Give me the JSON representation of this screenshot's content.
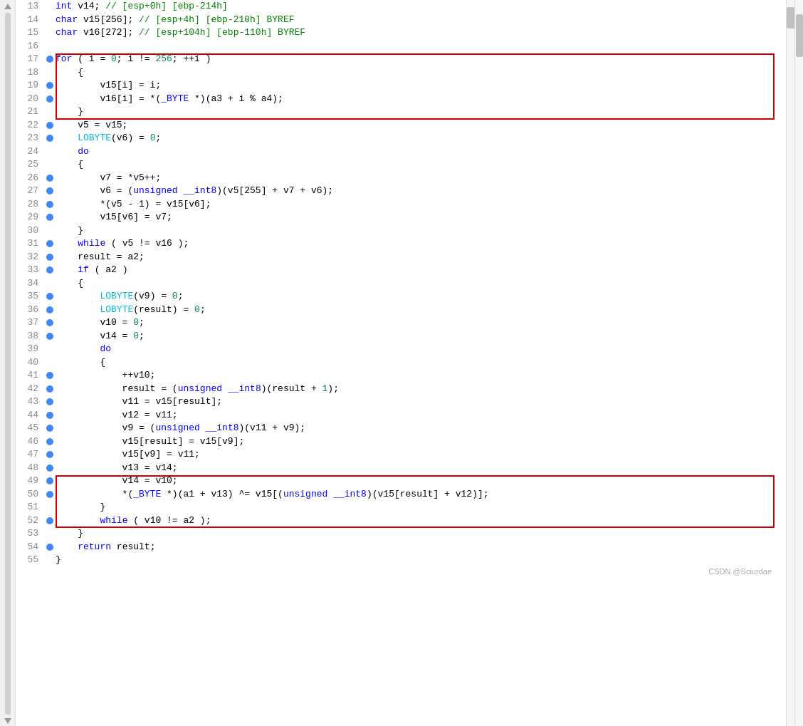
{
  "editor": {
    "background": "#ffffff",
    "lines": [
      {
        "num": "13",
        "has_bp": false,
        "highlighted": false,
        "tokens": [
          {
            "t": "type",
            "v": "int"
          },
          {
            "t": "plain",
            "v": " v14; // [esp+0h] [ebp-214h]"
          }
        ]
      },
      {
        "num": "14",
        "has_bp": false,
        "highlighted": false,
        "tokens": [
          {
            "t": "type",
            "v": "char"
          },
          {
            "t": "plain",
            "v": " v15[256]; // [esp+4h] [ebp-210h] BYREF"
          }
        ]
      },
      {
        "num": "15",
        "has_bp": false,
        "highlighted": false,
        "tokens": [
          {
            "t": "type",
            "v": "char"
          },
          {
            "t": "plain",
            "v": " v16[272]; // [esp+104h] [ebp-110h] BYREF"
          }
        ]
      },
      {
        "num": "16",
        "has_bp": false,
        "highlighted": false,
        "tokens": []
      },
      {
        "num": "17",
        "has_bp": true,
        "highlighted": false,
        "in_red_box_1": true,
        "tokens": [
          {
            "t": "kw",
            "v": "for"
          },
          {
            "t": "plain",
            "v": " ( i = "
          },
          {
            "t": "num",
            "v": "0"
          },
          {
            "t": "plain",
            "v": "; i != "
          },
          {
            "t": "num",
            "v": "256"
          },
          {
            "t": "plain",
            "v": "; ++i )"
          }
        ]
      },
      {
        "num": "18",
        "has_bp": false,
        "highlighted": false,
        "in_red_box_1": true,
        "tokens": [
          {
            "t": "plain",
            "v": "    {"
          }
        ]
      },
      {
        "num": "19",
        "has_bp": true,
        "highlighted": false,
        "in_red_box_1": true,
        "tokens": [
          {
            "t": "plain",
            "v": "        v15[i] = i;"
          }
        ]
      },
      {
        "num": "20",
        "has_bp": true,
        "highlighted": false,
        "in_red_box_1": true,
        "tokens": [
          {
            "t": "plain",
            "v": "        v16[i] = *("
          },
          {
            "t": "kw",
            "v": "_BYTE"
          },
          {
            "t": "plain",
            "v": " *)(a3 + i % a4);"
          }
        ]
      },
      {
        "num": "21",
        "has_bp": false,
        "highlighted": false,
        "in_red_box_1": true,
        "tokens": [
          {
            "t": "plain",
            "v": "    }"
          }
        ]
      },
      {
        "num": "22",
        "has_bp": true,
        "highlighted": false,
        "tokens": [
          {
            "t": "plain",
            "v": "    v5 = v15;"
          }
        ]
      },
      {
        "num": "23",
        "has_bp": true,
        "highlighted": false,
        "tokens": [
          {
            "t": "cyan",
            "v": "    LOBYTE"
          },
          {
            "t": "plain",
            "v": "(v6) = "
          },
          {
            "t": "num",
            "v": "0"
          },
          {
            "t": "plain",
            "v": ";"
          }
        ]
      },
      {
        "num": "24",
        "has_bp": false,
        "highlighted": false,
        "tokens": [
          {
            "t": "plain",
            "v": "    "
          },
          {
            "t": "kw",
            "v": "do"
          }
        ]
      },
      {
        "num": "25",
        "has_bp": false,
        "highlighted": false,
        "tokens": [
          {
            "t": "plain",
            "v": "    {"
          }
        ]
      },
      {
        "num": "26",
        "has_bp": true,
        "highlighted": false,
        "tokens": [
          {
            "t": "plain",
            "v": "        v7 = *v5++;"
          }
        ]
      },
      {
        "num": "27",
        "has_bp": true,
        "highlighted": false,
        "tokens": [
          {
            "t": "plain",
            "v": "        v6 = ("
          },
          {
            "t": "kw",
            "v": "unsigned"
          },
          {
            "t": "plain",
            "v": " "
          },
          {
            "t": "kw",
            "v": "__int8"
          },
          {
            "t": "plain",
            "v": ")(v5[255] + v7 + v6);"
          }
        ]
      },
      {
        "num": "28",
        "has_bp": true,
        "highlighted": false,
        "tokens": [
          {
            "t": "plain",
            "v": "        *(v5 - 1) = v15[v6];"
          }
        ]
      },
      {
        "num": "29",
        "has_bp": true,
        "highlighted": false,
        "tokens": [
          {
            "t": "plain",
            "v": "        v15[v6] = v7;"
          }
        ]
      },
      {
        "num": "30",
        "has_bp": false,
        "highlighted": false,
        "tokens": [
          {
            "t": "plain",
            "v": "    }"
          }
        ]
      },
      {
        "num": "31",
        "has_bp": true,
        "highlighted": false,
        "tokens": [
          {
            "t": "plain",
            "v": "    "
          },
          {
            "t": "kw",
            "v": "while"
          },
          {
            "t": "plain",
            "v": " ( v5 != v16 );"
          }
        ]
      },
      {
        "num": "32",
        "has_bp": true,
        "highlighted": false,
        "tokens": [
          {
            "t": "plain",
            "v": "    result = a2;"
          }
        ]
      },
      {
        "num": "33",
        "has_bp": true,
        "highlighted": false,
        "tokens": [
          {
            "t": "plain",
            "v": "    "
          },
          {
            "t": "kw",
            "v": "if"
          },
          {
            "t": "plain",
            "v": " ( a2 )"
          }
        ]
      },
      {
        "num": "34",
        "has_bp": false,
        "highlighted": false,
        "tokens": [
          {
            "t": "plain",
            "v": "    {"
          }
        ]
      },
      {
        "num": "35",
        "has_bp": true,
        "highlighted": false,
        "tokens": [
          {
            "t": "plain",
            "v": "        "
          },
          {
            "t": "cyan",
            "v": "LOBYTE"
          },
          {
            "t": "plain",
            "v": "(v9) = "
          },
          {
            "t": "num",
            "v": "0"
          },
          {
            "t": "plain",
            "v": ";"
          }
        ]
      },
      {
        "num": "36",
        "has_bp": true,
        "highlighted": false,
        "tokens": [
          {
            "t": "plain",
            "v": "        "
          },
          {
            "t": "cyan",
            "v": "LOBYTE"
          },
          {
            "t": "plain",
            "v": "(result) = "
          },
          {
            "t": "num",
            "v": "0"
          },
          {
            "t": "plain",
            "v": ";"
          }
        ]
      },
      {
        "num": "37",
        "has_bp": true,
        "highlighted": false,
        "tokens": [
          {
            "t": "plain",
            "v": "        v10 = "
          },
          {
            "t": "num",
            "v": "0"
          },
          {
            "t": "plain",
            "v": ";"
          }
        ]
      },
      {
        "num": "38",
        "has_bp": true,
        "highlighted": false,
        "tokens": [
          {
            "t": "plain",
            "v": "        v14 = "
          },
          {
            "t": "num",
            "v": "0"
          },
          {
            "t": "plain",
            "v": ";"
          }
        ]
      },
      {
        "num": "39",
        "has_bp": false,
        "highlighted": false,
        "tokens": [
          {
            "t": "plain",
            "v": "        "
          },
          {
            "t": "kw",
            "v": "do"
          }
        ]
      },
      {
        "num": "40",
        "has_bp": false,
        "highlighted": false,
        "tokens": [
          {
            "t": "plain",
            "v": "        {"
          }
        ]
      },
      {
        "num": "41",
        "has_bp": true,
        "highlighted": false,
        "tokens": [
          {
            "t": "plain",
            "v": "            ++v10;"
          }
        ]
      },
      {
        "num": "42",
        "has_bp": true,
        "highlighted": false,
        "tokens": [
          {
            "t": "plain",
            "v": "            result = ("
          },
          {
            "t": "kw",
            "v": "unsigned"
          },
          {
            "t": "plain",
            "v": " "
          },
          {
            "t": "kw",
            "v": "__int8"
          },
          {
            "t": "plain",
            "v": ")(result + "
          },
          {
            "t": "num",
            "v": "1"
          },
          {
            "t": "plain",
            "v": ");"
          }
        ]
      },
      {
        "num": "43",
        "has_bp": true,
        "highlighted": false,
        "tokens": [
          {
            "t": "plain",
            "v": "            v11 = v15[result];"
          }
        ]
      },
      {
        "num": "44",
        "has_bp": true,
        "highlighted": false,
        "tokens": [
          {
            "t": "plain",
            "v": "            v12 = v11;"
          }
        ]
      },
      {
        "num": "45",
        "has_bp": true,
        "highlighted": false,
        "tokens": [
          {
            "t": "plain",
            "v": "            v9 = ("
          },
          {
            "t": "kw",
            "v": "unsigned"
          },
          {
            "t": "plain",
            "v": " "
          },
          {
            "t": "kw",
            "v": "__int8"
          },
          {
            "t": "plain",
            "v": ")(v11 + v9);"
          }
        ]
      },
      {
        "num": "46",
        "has_bp": true,
        "highlighted": false,
        "tokens": [
          {
            "t": "plain",
            "v": "            v15[result] = v15[v9];"
          }
        ]
      },
      {
        "num": "47",
        "has_bp": true,
        "highlighted": false,
        "tokens": [
          {
            "t": "plain",
            "v": "            v15[v9] = v11;"
          }
        ]
      },
      {
        "num": "48",
        "has_bp": true,
        "highlighted": false,
        "tokens": [
          {
            "t": "plain",
            "v": "            v13 = v14;"
          }
        ]
      },
      {
        "num": "49",
        "has_bp": true,
        "highlighted": false,
        "in_red_box_2": true,
        "tokens": [
          {
            "t": "plain",
            "v": "            v14 = v10;"
          }
        ]
      },
      {
        "num": "50",
        "has_bp": true,
        "highlighted": false,
        "in_red_box_2": true,
        "tokens": [
          {
            "t": "plain",
            "v": "            *("
          },
          {
            "t": "kw",
            "v": "_BYTE"
          },
          {
            "t": "plain",
            "v": " *)(a1 + v13) ^= v15[("
          },
          {
            "t": "kw",
            "v": "unsigned"
          },
          {
            "t": "plain",
            "v": " "
          },
          {
            "t": "kw",
            "v": "__int8"
          },
          {
            "t": "plain",
            "v": ")(v15[result] + v12)];"
          }
        ]
      },
      {
        "num": "51",
        "has_bp": false,
        "highlighted": false,
        "in_red_box_2": true,
        "tokens": [
          {
            "t": "plain",
            "v": "        }"
          }
        ]
      },
      {
        "num": "52",
        "has_bp": true,
        "highlighted": false,
        "in_red_box_2": true,
        "tokens": [
          {
            "t": "plain",
            "v": "        "
          },
          {
            "t": "kw",
            "v": "while"
          },
          {
            "t": "plain",
            "v": " ( v10 != a2 );"
          }
        ]
      },
      {
        "num": "53",
        "has_bp": false,
        "highlighted": false,
        "tokens": [
          {
            "t": "plain",
            "v": "    }"
          }
        ]
      },
      {
        "num": "54",
        "has_bp": true,
        "highlighted": false,
        "tokens": [
          {
            "t": "plain",
            "v": "    "
          },
          {
            "t": "kw",
            "v": "return"
          },
          {
            "t": "plain",
            "v": " result;"
          }
        ]
      },
      {
        "num": "55",
        "has_bp": false,
        "highlighted": false,
        "tokens": [
          {
            "t": "plain",
            "v": "}"
          }
        ]
      }
    ],
    "watermark": "CSDN @Sciurdae",
    "red_box_1": {
      "top_line": 17,
      "bottom_line": 21
    },
    "red_box_2": {
      "top_line": 49,
      "bottom_line": 52
    }
  },
  "header": {
    "highlighted_word": "int"
  }
}
